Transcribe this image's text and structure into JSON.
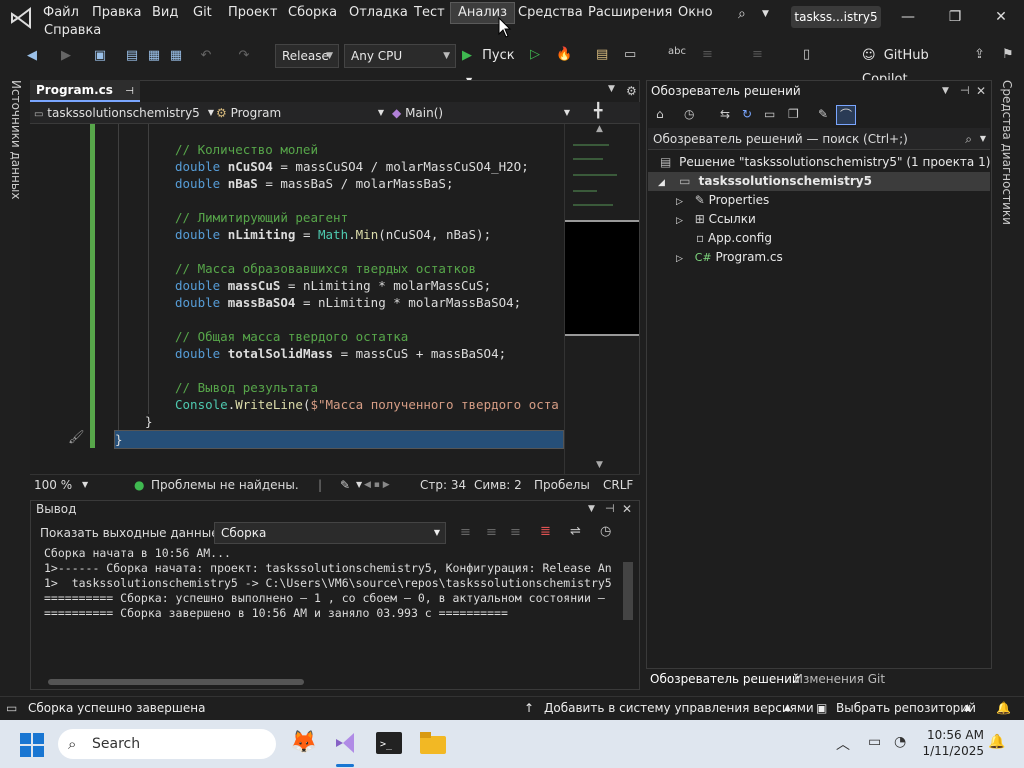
{
  "menu": {
    "items": [
      "Файл",
      "Правка",
      "Вид",
      "Git",
      "Проект",
      "Сборка",
      "Отладка",
      "Тест",
      "Анализ",
      "Средства",
      "Расширения",
      "Окно"
    ],
    "second_row": "Справка",
    "window_title": "taskss...istry5"
  },
  "toolbar": {
    "config": "Release",
    "platform": "Any CPU",
    "run_label": "Пуск",
    "copilot": "GitHub Copilot"
  },
  "left_strip": "Источники данных",
  "right_strip": "Средства диагностики",
  "editor": {
    "tab": "Program.cs",
    "nav_project": "taskssolutionschemistry5",
    "nav_class": "Program",
    "nav_method": "Main()",
    "zoom": "100 %",
    "issues": "Проблемы не найдены.",
    "line": "Стр: 34",
    "col": "Симв: 2",
    "whitespace": "Пробелы",
    "eol": "CRLF"
  },
  "code": {
    "l1": "// Количество молей",
    "l2_a": "double ",
    "l2_b": "nCuSO4",
    "l2_c": " = massCuSO4 / molarMassCuSO4_H2O;",
    "l3_a": "double ",
    "l3_b": "nBaS",
    "l3_c": " = massBaS / molarMassBaS;",
    "l4": "// Лимитирующий реагент",
    "l5_a": "double ",
    "l5_b": "nLimiting",
    "l5_c": " = ",
    "l5_d": "Math",
    "l5_e": ".",
    "l5_f": "Min",
    "l5_g": "(nCuSO4, nBaS);",
    "l6": "// Масса образовавшихся твердых остатков",
    "l7_a": "double ",
    "l7_b": "massCuS",
    "l7_c": " = nLimiting * molarMassCuS;",
    "l8_a": "double ",
    "l8_b": "massBaSO4",
    "l8_c": " = nLimiting * molarMassBaSO4;",
    "l9": "// Общая масса твердого остатка",
    "l10_a": "double ",
    "l10_b": "totalSolidMass",
    "l10_c": " = massCuS + massBaSO4;",
    "l11": "// Вывод результата",
    "l12_a": "Console",
    "l12_b": ".",
    "l12_c": "WriteLine",
    "l12_d": "(",
    "l12_e": "$\"Масса полученного твердого оста",
    "l13": "}",
    "l14": "}"
  },
  "output": {
    "title": "Вывод",
    "show_label": "Показать выходные данные из:",
    "source": "Сборка",
    "lines": [
      "Сборка начата в 10:56 AM...",
      "1>------ Сборка начата: проект: taskssolutionschemistry5, Конфигурация: Release An",
      "1>  taskssolutionschemistry5 -> C:\\Users\\VM6\\source\\repos\\taskssolutionschemistry5",
      "========== Сборка: успешно выполнено — 1 , со сбоем — 0, в актуальном состоянии —",
      "========== Сборка завершено в 10:56 AM и заняло 03.993 с =========="
    ]
  },
  "solution": {
    "title": "Обозреватель решений",
    "search_placeholder": "Обозреватель решений — поиск (Ctrl+;)",
    "solution_row": "Решение \"taskssolutionschemistry5\"  (1 проекта 1)",
    "project": "taskssolutionschemistry5",
    "items": [
      "Properties",
      "Ссылки",
      "App.config",
      "Program.cs"
    ],
    "tab_active": "Обозреватель решений",
    "tab_git": "Изменения Git"
  },
  "statusbar": {
    "message": "Сборка успешно завершена",
    "vcs": "Добавить в систему управления версиями",
    "repo": "Выбрать репозиторий"
  },
  "taskbar": {
    "search": "Search",
    "time": "10:56 AM",
    "date": "1/11/2025"
  },
  "colors": {
    "accent": "#7aa6ff",
    "keyword": "#569cd6",
    "comment": "#57a64a",
    "success": "#3fb950"
  }
}
